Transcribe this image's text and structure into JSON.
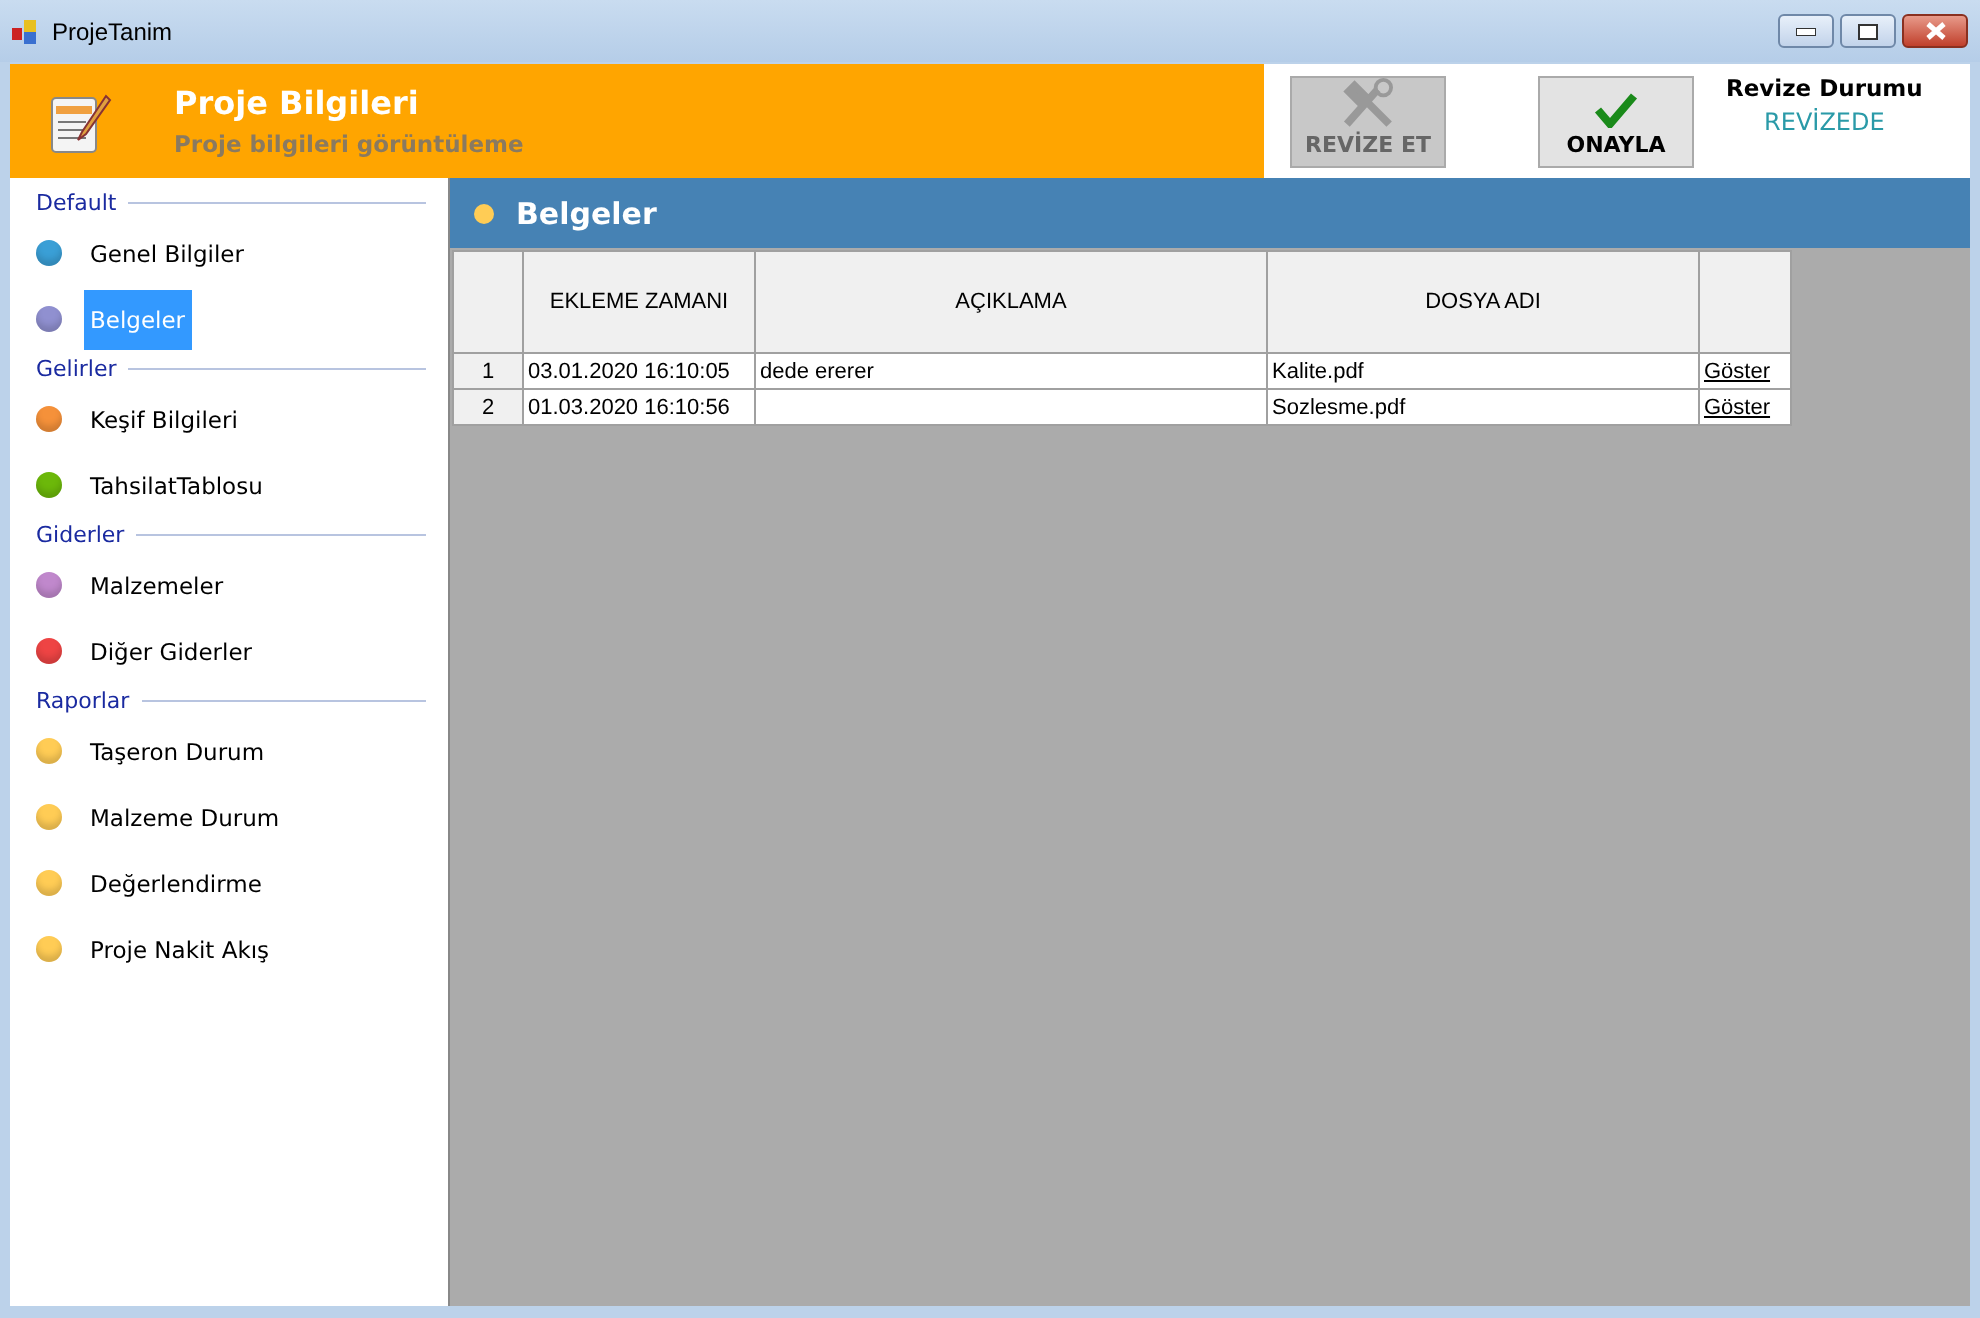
{
  "window": {
    "title": "ProjeTanim"
  },
  "header": {
    "title": "Proje Bilgileri",
    "subtitle": "Proje bilgileri görüntüleme"
  },
  "actions": [
    {
      "label": "REVİZE ET",
      "kind": "tools",
      "disabled": true
    },
    {
      "label": "ONAYLA",
      "kind": "check",
      "disabled": false
    }
  ],
  "revision_status": {
    "label": "Revize Durumu",
    "value": "REVİZEDE"
  },
  "sidebar": {
    "groups": [
      {
        "title": "Default",
        "items": [
          {
            "label": "Genel Bilgiler",
            "color": "#3a9fd6",
            "selected": false
          },
          {
            "label": "Belgeler",
            "color": "#9090d0",
            "selected": true
          }
        ]
      },
      {
        "title": "Gelirler",
        "items": [
          {
            "label": "Keşif Bilgileri",
            "color": "#f5913a",
            "selected": false
          },
          {
            "label": "TahsilatTablosu",
            "color": "#6cb80a",
            "selected": false
          }
        ]
      },
      {
        "title": "Giderler",
        "items": [
          {
            "label": "Malzemeler",
            "color": "#c088cc",
            "selected": false
          },
          {
            "label": "Diğer Giderler",
            "color": "#ee4444",
            "selected": false
          }
        ]
      },
      {
        "title": "Raporlar",
        "items": [
          {
            "label": "Taşeron Durum",
            "color": "#ffcc55",
            "selected": false
          },
          {
            "label": "Malzeme Durum",
            "color": "#ffcc55",
            "selected": false
          },
          {
            "label": "Değerlendirme",
            "color": "#ffcc55",
            "selected": false
          },
          {
            "label": "Proje Nakit Akış",
            "color": "#ffcc55",
            "selected": false
          }
        ]
      }
    ]
  },
  "panel": {
    "title": "Belgeler"
  },
  "table": {
    "columns": [
      "EKLEME ZAMANI",
      "AÇIKLAMA",
      "DOSYA ADI"
    ],
    "rows": [
      {
        "number": "1",
        "cells": [
          "03.01.2020 16:10:05",
          "dede ererer",
          "Kalite.pdf"
        ],
        "link": "Göster"
      },
      {
        "number": "2",
        "cells": [
          "01.03.2020 16:10:56",
          "",
          "Sozlesme.pdf"
        ],
        "link": "Göster"
      }
    ]
  }
}
